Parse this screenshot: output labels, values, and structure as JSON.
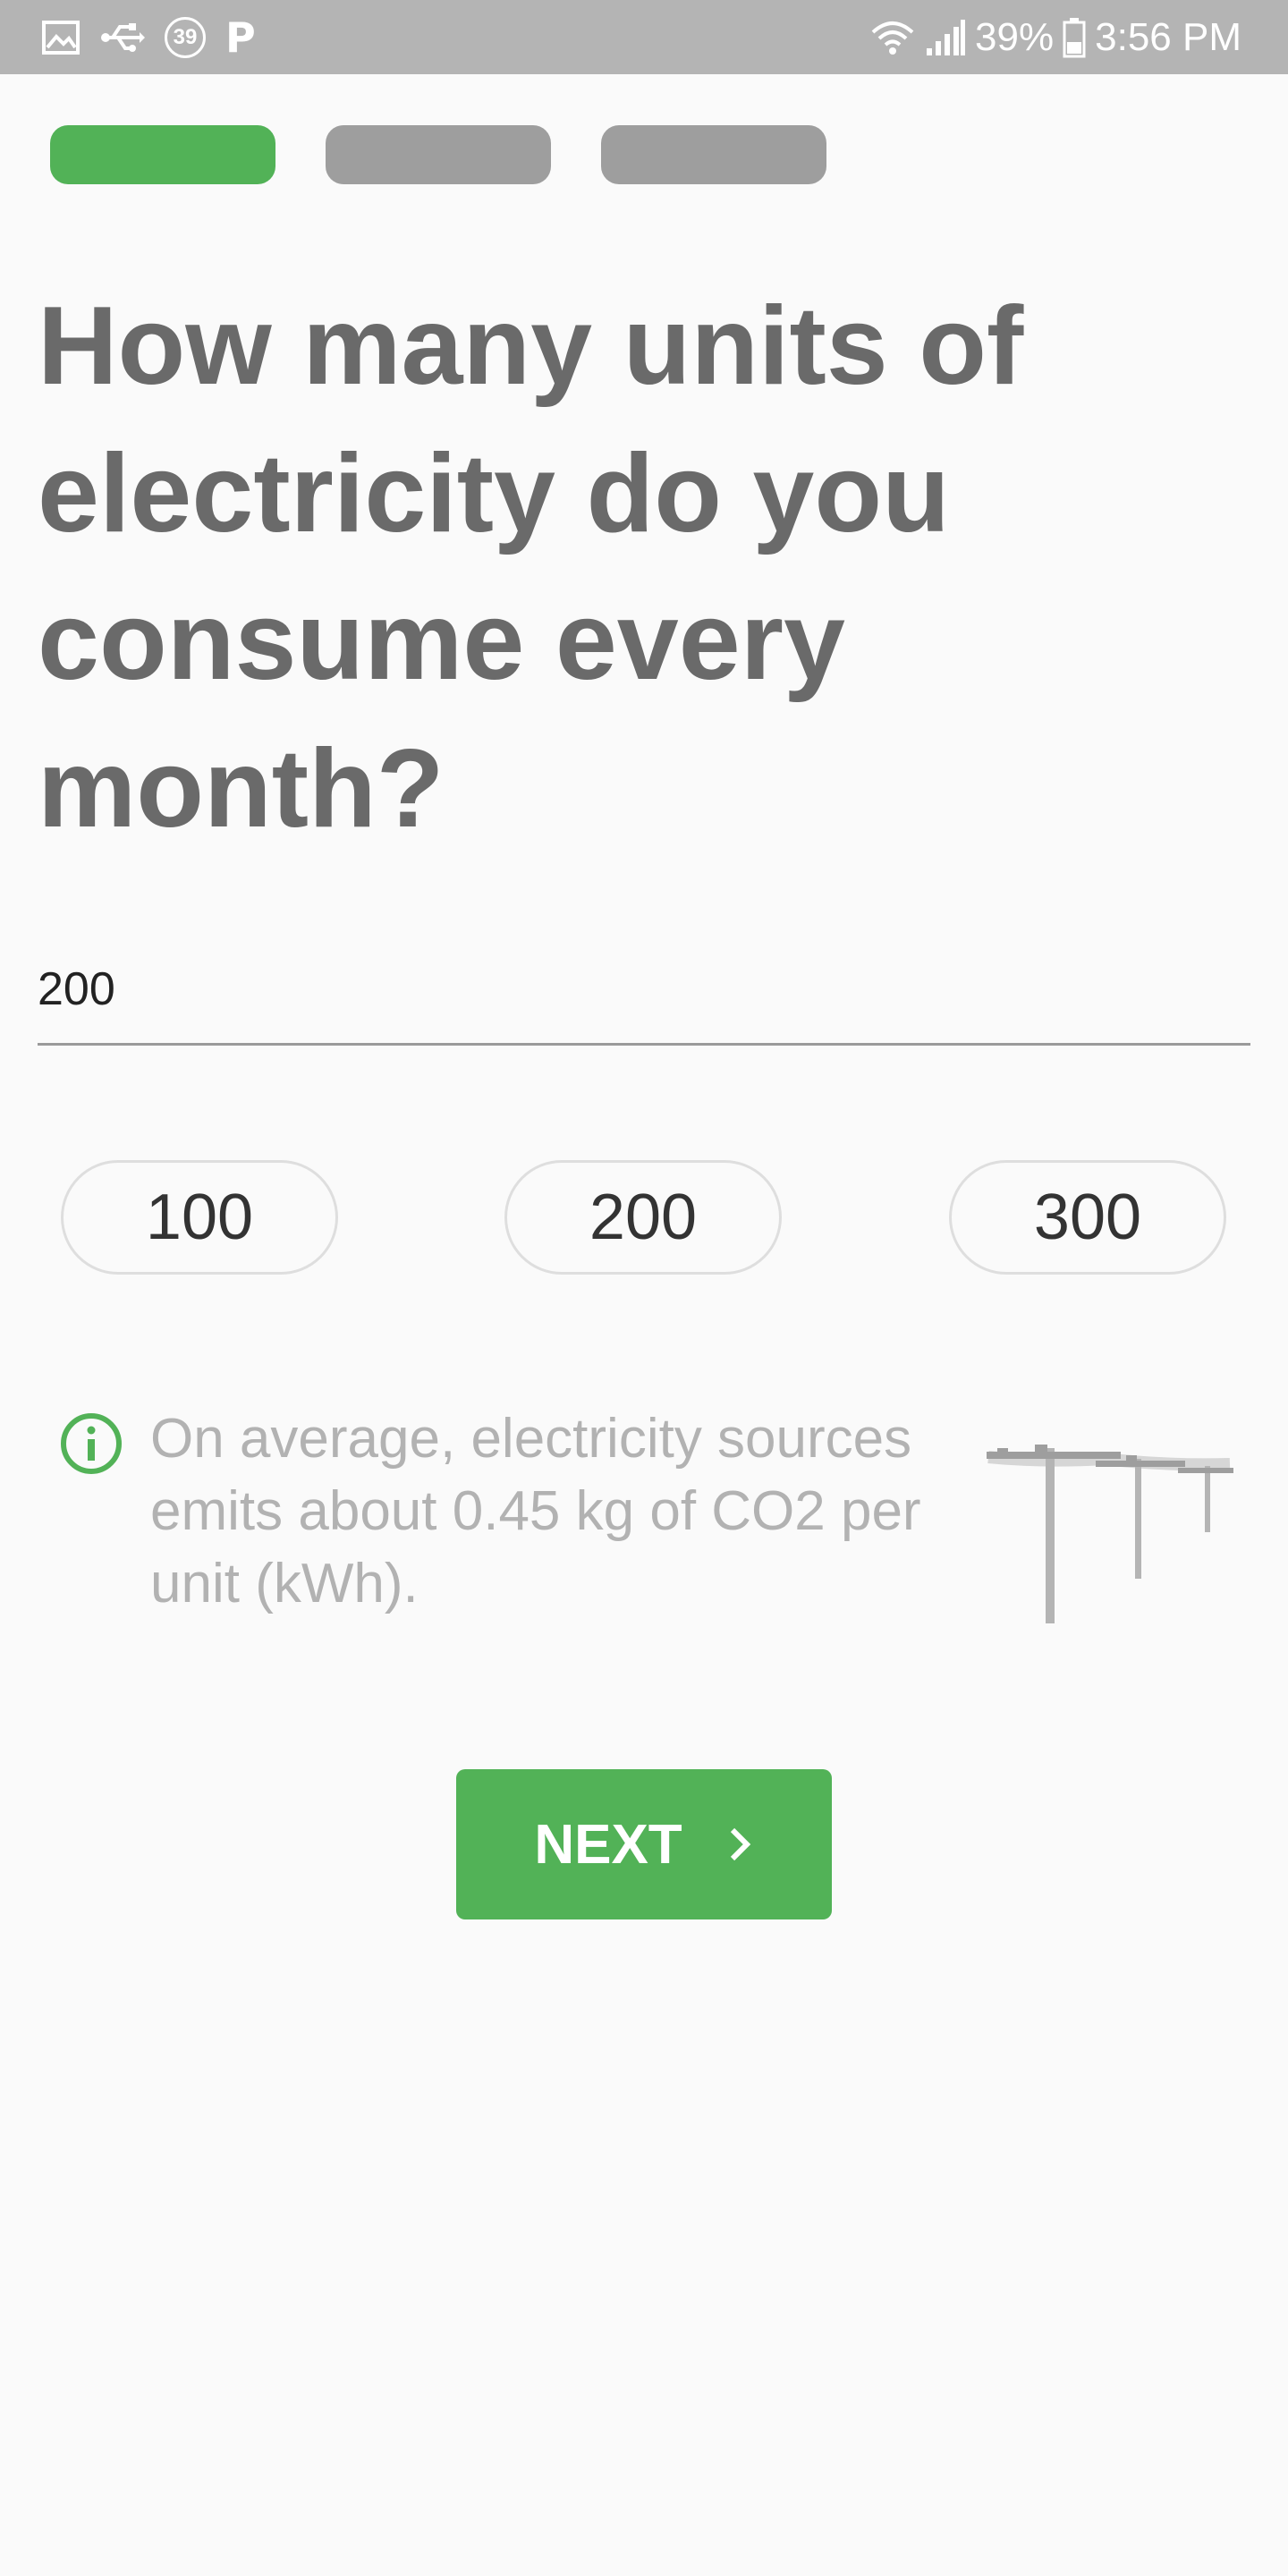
{
  "status_bar": {
    "icons": [
      "image-icon",
      "usb-icon",
      "notification-count-icon",
      "parking-icon",
      "wifi-icon",
      "signal-icon",
      "battery-icon"
    ],
    "notification_count": "39",
    "app_badge": "P",
    "battery": "39%",
    "time": "3:56 PM"
  },
  "progress": {
    "total_steps": 3,
    "current_step": 1,
    "active_color": "#52b257",
    "inactive_color": "#9e9e9e"
  },
  "question": "How many units of electricity do you consume every month?",
  "units_input": {
    "value": "200"
  },
  "presets": [
    "100",
    "200",
    "300"
  ],
  "info": {
    "icon": "info-icon",
    "text": "On average, electricity sources emits about 0.45 kg of CO2 per unit (kWh).",
    "illustration": "power-lines-illustration"
  },
  "next_button": {
    "label": "NEXT",
    "icon": "chevron-right-icon",
    "color": "#52b257"
  }
}
